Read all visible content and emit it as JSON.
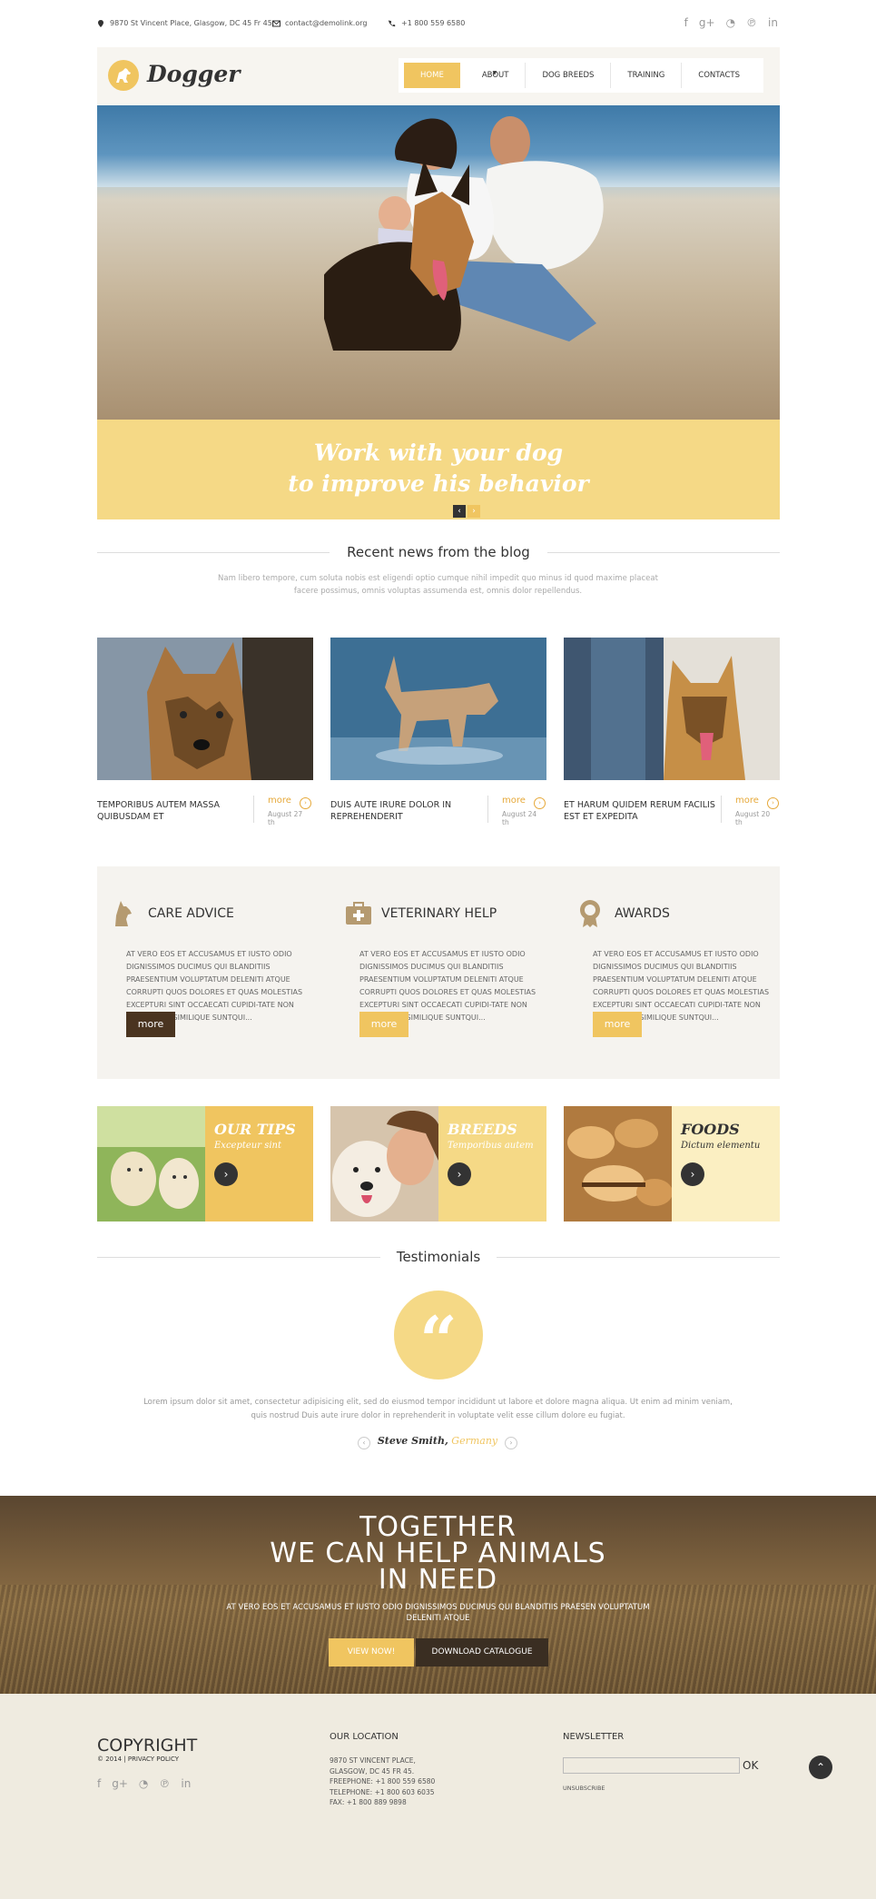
{
  "topbar": {
    "address": "9870 St Vincent Place, Glasgow, DC 45 Fr 45.",
    "email": "contact@demolink.org",
    "phone": "+1 800 559 6580",
    "social": [
      "f",
      "g+",
      "rss",
      "p",
      "in"
    ]
  },
  "header": {
    "logo": "Dogger",
    "nav": [
      {
        "label": "HOME"
      },
      {
        "label": "ABOUT"
      },
      {
        "label": "DOG BREEDS"
      },
      {
        "label": "TRAINING"
      },
      {
        "label": "CONTACTS"
      }
    ]
  },
  "hero": {
    "title_line1": "Work with your dog",
    "title_line2": "to improve his behavior",
    "prev": "‹",
    "next": "›"
  },
  "blog": {
    "title": "Recent news from the blog",
    "intro": "Nam libero tempore, cum soluta nobis est eligendi optio cumque nihil impedit quo minus id quod maxime placeat facere possimus, omnis voluptas assumenda est, omnis dolor repellendus.",
    "posts": [
      {
        "title": "TEMPORIBUS AUTEM MASSA QUIBUSDAM ET",
        "more": "more",
        "date": "August 27 th"
      },
      {
        "title": "DUIS AUTE IRURE DOLOR IN REPREHENDERIT",
        "more": "more",
        "date": "August 24 th"
      },
      {
        "title": "ET HARUM QUIDEM RERUM FACILIS EST ET EXPEDITA",
        "more": "more",
        "date": "August 20 th"
      }
    ]
  },
  "services": [
    {
      "title": "CARE ADVICE",
      "text": "AT VERO EOS ET ACCUSAMUS ET IUSTO ODIO dignissimos ducimus qui blanditiis praesentium voluptatum deleniti atque corrupti quos dolores et quas molestias excepturi sint occaecati cupidi-tate non provident, similique suntqui...",
      "button": "more",
      "icon": "dog-icon"
    },
    {
      "title": "VETERINARY HELP",
      "text": "AT VERO EOS ET ACCUSAMUS ET IUSTO ODIO dignissimos ducimus qui blanditiis praesentium voluptatum deleniti atque corrupti quos dolores et quas molestias excepturi sint occaecati cupidi-tate non provident, similique suntqui...",
      "button": "more",
      "icon": "medical-kit-icon"
    },
    {
      "title": "AWARDS",
      "text": "AT VERO EOS ET ACCUSAMUS ET IUSTO ODIO dignissimos ducimus qui blanditiis praesentium voluptatum deleniti atque corrupti quos dolores et quas molestias excepturi sint occaecati cupidi-tate non provident, similique suntqui...",
      "button": "more",
      "icon": "award-icon"
    }
  ],
  "promos": [
    {
      "title": "OUR TIPS",
      "subtitle": "Excepteur sint"
    },
    {
      "title": "BREEDS",
      "subtitle": "Temporibus autem"
    },
    {
      "title": "FOODS",
      "subtitle": "Dictum elementu"
    }
  ],
  "testimonials": {
    "title": "Testimonials",
    "text": "Lorem ipsum dolor sit amet, consectetur adipisicing elit, sed do eiusmod tempor incididunt ut labore et dolore magna aliqua. Ut enim ad minim veniam, quis nostrud Duis aute irure dolor in reprehenderit in voluptate velit esse cillum dolore eu fugiat.",
    "author": "Steve Smith,",
    "country": "Germany",
    "quote_mark": "“"
  },
  "banner": {
    "line1": "TOGETHER",
    "line2": "WE CAN HELP ANIMALS",
    "line3": "IN NEED",
    "sub": "AT VERO EOS ET ACCUSAMUS ET IUSTO ODIO DIGNISSIMOS DUCIMUS QUI BLANDITIIS PRAESEN VOLUPTATUM DELENITI ATQUE",
    "btn_view": "VIEW NOW!",
    "btn_download": "DOWNLOAD CATALOGUE"
  },
  "footer": {
    "copyright": "COPYRIGHT",
    "copyright_sub": "© 2014 | PRIVACY POLICY",
    "location_title": "OUR LOCATION",
    "location_lines": [
      "9870 St Vincent Place,",
      "Glasgow, DC 45 Fr 45.",
      "Freephone:   +1 800 559 6580",
      "Telephone:   +1 800 603 6035",
      "FAX:            +1 800 889 9898"
    ],
    "newsletter_title": "NEWSLETTER",
    "ok": "OK",
    "unsubscribe": "UNSUBSCRIBE",
    "to_top": "⌃"
  },
  "colors": {
    "accent": "#f0c560",
    "accent_light": "#f5d986",
    "dark": "#333333",
    "brown_button": "#4a3420"
  }
}
